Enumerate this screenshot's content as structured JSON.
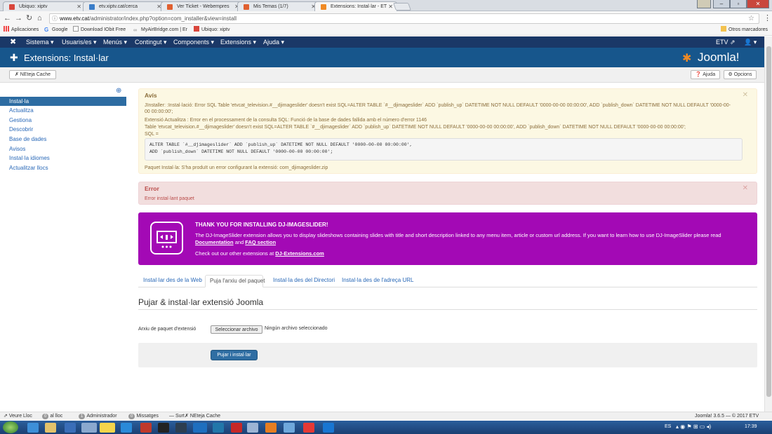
{
  "browser": {
    "tabs": [
      {
        "label": "Ubiquo: xiptv"
      },
      {
        "label": "etv.xiptv.cat/cerca"
      },
      {
        "label": "Ver Ticket - Webempres"
      },
      {
        "label": "Mis Temas (1/7)"
      },
      {
        "label": "Extensions: Instal·lar - ET"
      }
    ],
    "url_host": "www.etv.cat",
    "url_path": "/administrator/index.php?option=com_installer&view=install",
    "bookmarks": [
      "Aplicaciones",
      "Google",
      "Download IObit Free",
      "MyAirBridge.com | Er",
      "Ubiquo: xiptv"
    ],
    "other_bookmarks": "Otros marcadores"
  },
  "nav": {
    "items": [
      "Sistema ▾",
      "Usuaris/es ▾",
      "Menús ▾",
      "Contingut ▾",
      "Components ▾",
      "Extensions ▾",
      "Ajuda ▾"
    ],
    "right": "ETV ⇗",
    "user": "👤 ▾"
  },
  "header": {
    "title": "Extensions: Instal·lar",
    "logo": "Joomla!"
  },
  "toolbar": {
    "clear_cache": "NEteja Cache",
    "help": "Ajuda",
    "options": "Opcions"
  },
  "sidebar": {
    "items": [
      "Instal·la",
      "Actualitza",
      "Gestiona",
      "Descobrir",
      "Base de dades",
      "Avisos",
      "Instal·la idiomes",
      "Actualitzar llocs"
    ]
  },
  "warning": {
    "title": "Avís",
    "line1": "JInstaller: :Instal·lació: Error SQL Table 'etvcat_television.#__djimageslider' doesn't exist SQL=ALTER TABLE `#__djimageslider` ADD `publish_up` DATETIME NOT NULL DEFAULT '0000-00-00 00:00:00', ADD `publish_down` DATETIME NOT NULL DEFAULT '0000-00-00 00:00:00';",
    "line2": "Extensió Actualitza : Error en el processament de la consulta SQL: Funció de la base de dades fallida amb el número d'error 1146",
    "line3": "Table 'etvcat_television.#__djimageslider' doesn't exist SQL=ALTER TABLE `#__djimageslider` ADD `publish_up` DATETIME NOT NULL DEFAULT '0000-00-00 00:00:00', ADD `publish_down` DATETIME NOT NULL DEFAULT '0000-00-00 00:00:00';",
    "sql_label": "SQL =",
    "sql_code": "ALTER TABLE `#__djimageslider` ADD `publish_up` DATETIME NOT NULL DEFAULT '0000-00-00 00:00:00',\nADD `publish_down` DATETIME NOT NULL DEFAULT '0000-00-00 00:00:00';",
    "footer": "Paquet Instal·la: S'ha produït un error configurant la extensió: com_djimageslider.zip"
  },
  "error": {
    "title": "Error",
    "message": "Error instal·lant paquet"
  },
  "promo": {
    "heading": "THANK YOU FOR INSTALLING DJ-IMAGESLIDER!",
    "text": "The DJ-ImageSlider extension allows you to display slideshows containing slides with title and short description linked to any menu item, article or custom url address. If you want to learn how to use DJ-ImageSlider please read",
    "doc_link": "Documentation",
    "and": "and",
    "faq_link": "FAQ section",
    "other_text": "Check out our other extensions at",
    "site_link": "DJ-Extensions.com"
  },
  "tabs": [
    {
      "label": "Instal·lar des de la Web"
    },
    {
      "label": "Puja l'arxiu del paquet"
    },
    {
      "label": "Instal·la des del Directori"
    },
    {
      "label": "Instal·la des de l'adreça URL"
    }
  ],
  "upload": {
    "title": "Pujar & instal·lar extensió Joomla",
    "file_label": "Arxiu de paquet d'extensió",
    "choose_button": "Seleccionar archivo",
    "no_file": "Ningún archivo seleccionado",
    "submit": "Pujar i instal·lar"
  },
  "footer": {
    "view_site": "Veure Lloc",
    "online_count": "0",
    "online_label": "al lloc",
    "admin_count": "1",
    "admin_label": "Administrador",
    "msg_count": "0",
    "msg_label": "Missatges",
    "logout": "— Surt",
    "clear_cache": "NEteja Cache",
    "version": "Joomla! 3.6.5 — © 2017 ETV"
  },
  "taskbar": {
    "lang": "ES",
    "time": "17:39"
  },
  "colors": {
    "nav": "#1a3867",
    "header": "#17568c",
    "promo": "#a309b5",
    "accent": "#2d6ca2"
  }
}
